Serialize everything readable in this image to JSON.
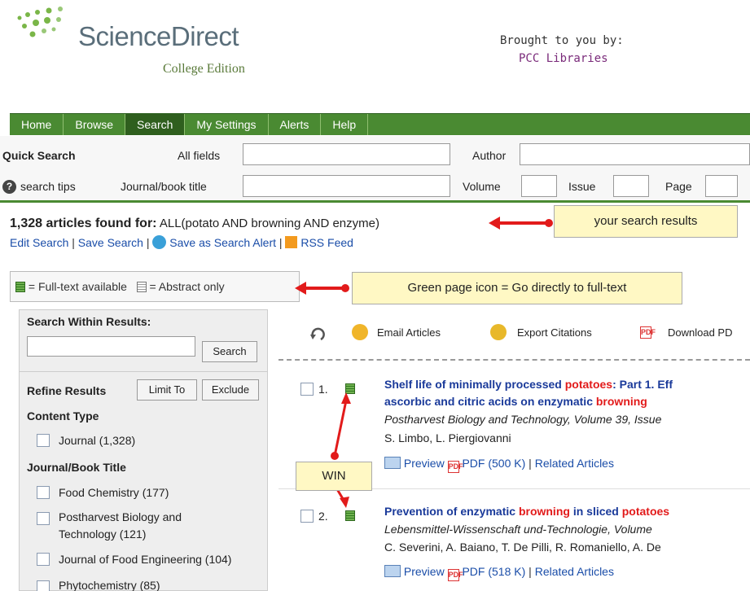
{
  "header": {
    "logo_text": "ScienceDirect",
    "logo_sub": "College Edition",
    "brought_by": "Brought to you by:",
    "library": "PCC Libraries"
  },
  "nav": [
    "Home",
    "Browse",
    "Search",
    "My Settings",
    "Alerts",
    "Help"
  ],
  "quick_search": {
    "title": "Quick Search",
    "all_fields": "All fields",
    "author": "Author",
    "search_tips": "search tips",
    "journal_title": "Journal/book title",
    "volume": "Volume",
    "issue": "Issue",
    "page": "Page"
  },
  "results_header": {
    "count": "1,328 articles found for:",
    "query": "ALL(potato AND browning AND enzyme)",
    "edit_search": "Edit Search",
    "save_search": "Save Search",
    "save_alert": "Save as Search Alert",
    "rss": "RSS Feed"
  },
  "callouts": {
    "results": "your search results",
    "green_page": "Green page icon = Go directly to full-text",
    "win": "WIN"
  },
  "legend": {
    "full_text": "= Full-text available",
    "abstract": "= Abstract only"
  },
  "sidebar": {
    "search_within": "Search Within Results:",
    "search_btn": "Search",
    "refine": "Refine Results",
    "limit_to": "Limit To",
    "exclude": "Exclude",
    "content_type": "Content Type",
    "journal": "Journal (1,328)",
    "journal_book_title": "Journal/Book Title",
    "titles": [
      "Food Chemistry (177)",
      "Postharvest Biology and",
      "Technology (121)",
      "Journal of Food Engineering (104)",
      "Phytochemistry (85)"
    ]
  },
  "toolbar": {
    "email": "Email Articles",
    "export": "Export Citations",
    "download": "Download PD"
  },
  "results": [
    {
      "num": "1.",
      "title_a": "Shelf life of minimally processed ",
      "title_hl1": "potatoes",
      "title_b": ": Part 1. Eff",
      "title2_a": "ascorbic and citric acids on enzymatic ",
      "title2_hl": "browning",
      "source": "Postharvest Biology and Technology, Volume 39, Issue",
      "authors": "S. Limbo, L. Piergiovanni",
      "preview": "Preview",
      "pdf": "PDF (500 K)",
      "related": "Related Articles"
    },
    {
      "num": "2.",
      "title_a": "Prevention of enzymatic ",
      "title_hl1": "browning",
      "title_b": " in sliced ",
      "title_hl2": "potatoes",
      "source": "Lebensmittel-Wissenschaft und-Technologie, Volume",
      "authors": "C. Severini, A. Baiano, T. De Pilli, R. Romaniello, A. De",
      "preview": "Preview",
      "pdf": "PDF (518 K)",
      "related": "Related Articles"
    }
  ],
  "colors": {
    "nav_green": "#4a8a32",
    "highlight_red": "#e21b1b",
    "link_blue": "#1a4da8",
    "callout_yellow": "#fff8c4"
  }
}
